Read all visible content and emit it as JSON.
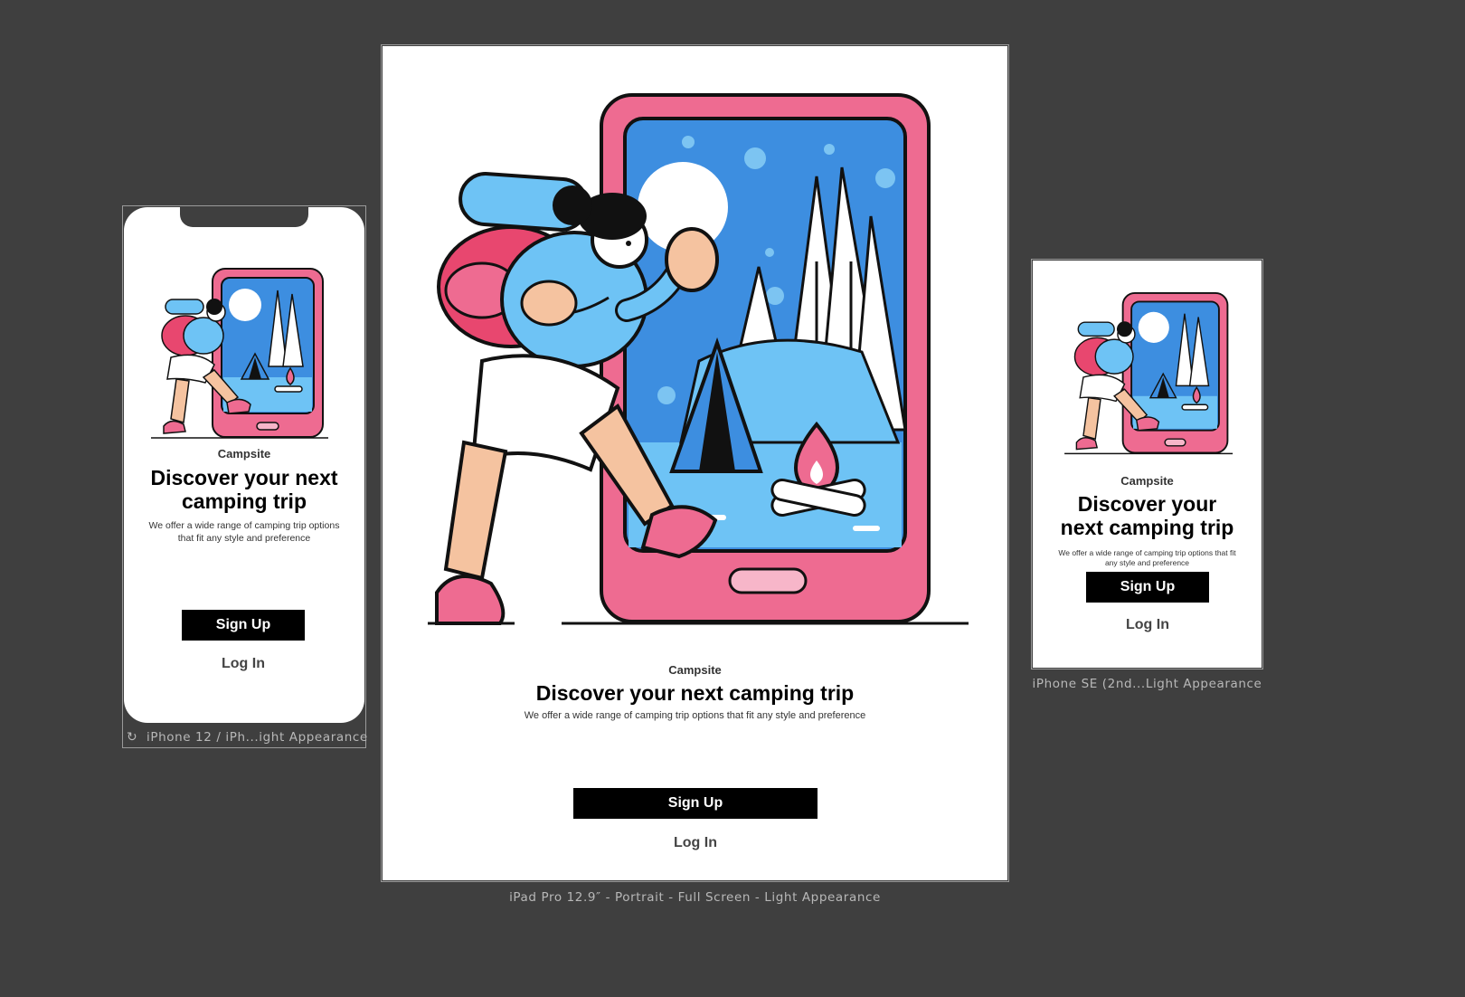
{
  "app": {
    "name": "Campsite",
    "headline": "Discover your next camping trip",
    "subtitle": "We offer a wide range of camping trip options that fit any style and preference",
    "signup_label": "Sign Up",
    "login_label": "Log In"
  },
  "previews": {
    "iphone12": "iPhone 12 / iPh...ight Appearance",
    "ipad": "iPad Pro 12.9″ - Portrait - Full Screen - Light Appearance",
    "iphonese": "iPhone SE (2nd...Light Appearance"
  },
  "colors": {
    "canvas": "#3f3f3f",
    "phone_pink": "#ee6b91",
    "screen_blue": "#3d8ee0",
    "water_blue": "#6ec3f5",
    "button_black": "#000000"
  }
}
